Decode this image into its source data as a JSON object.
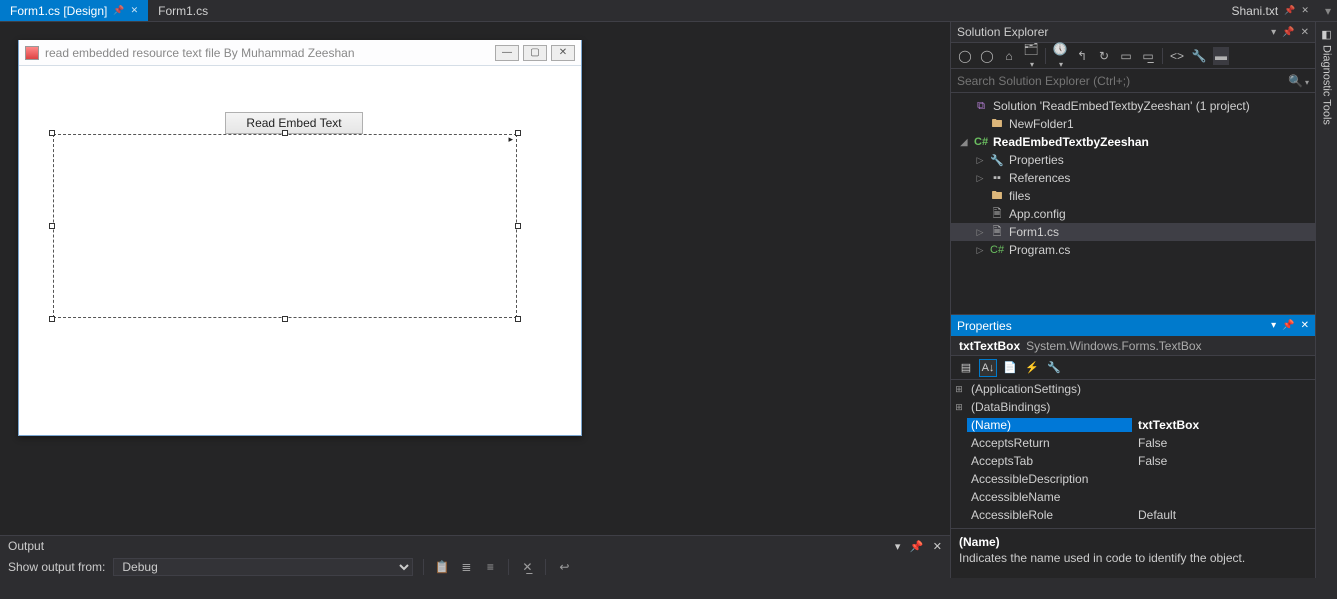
{
  "tabs": {
    "left": [
      {
        "label": "Form1.cs [Design]",
        "active": true,
        "pinned": true
      },
      {
        "label": "Form1.cs",
        "active": false
      }
    ],
    "right": [
      {
        "label": "Shani.txt"
      }
    ]
  },
  "winform": {
    "title": "read embedded resource text file By Muhammad Zeeshan",
    "button_label": "Read Embed Text"
  },
  "output": {
    "title": "Output",
    "show_from_label": "Show output from:",
    "dropdown_value": "Debug"
  },
  "solution_explorer": {
    "title": "Solution Explorer",
    "search_placeholder": "Search Solution Explorer (Ctrl+;)",
    "nodes": [
      {
        "exp": "",
        "label": "Solution 'ReadEmbedTextbyZeeshan' (1 project)",
        "icon": "sol-ico",
        "ind": 0
      },
      {
        "exp": "",
        "label": "NewFolder1",
        "icon": "folder-ico",
        "ind": 1
      },
      {
        "exp": "◢",
        "label": "ReadEmbedTextbyZeeshan",
        "icon": "cs-ico",
        "ind": 0,
        "bold": true
      },
      {
        "exp": "▷",
        "label": "Properties",
        "icon": "wrench-ico",
        "ind": 1
      },
      {
        "exp": "▷",
        "label": "References",
        "icon": "ref-ico",
        "ind": 1
      },
      {
        "exp": "",
        "label": "files",
        "icon": "folder-ico",
        "ind": 1
      },
      {
        "exp": "",
        "label": "App.config",
        "icon": "cfg-ico",
        "ind": 1
      },
      {
        "exp": "▷",
        "label": "Form1.cs",
        "icon": "cfg-ico",
        "ind": 1,
        "sel": true
      },
      {
        "exp": "▷",
        "label": "Program.cs",
        "icon": "cs-ico",
        "ind": 1
      }
    ]
  },
  "properties": {
    "title": "Properties",
    "object_name": "txtTextBox",
    "object_type": "System.Windows.Forms.TextBox",
    "rows": [
      {
        "exp": "⊞",
        "name": "(ApplicationSettings)",
        "val": "",
        "cat": true
      },
      {
        "exp": "⊞",
        "name": "(DataBindings)",
        "val": "",
        "cat": true
      },
      {
        "exp": "",
        "name": "(Name)",
        "val": "txtTextBox",
        "sel": true
      },
      {
        "exp": "",
        "name": "AcceptsReturn",
        "val": "False"
      },
      {
        "exp": "",
        "name": "AcceptsTab",
        "val": "False"
      },
      {
        "exp": "",
        "name": "AccessibleDescription",
        "val": ""
      },
      {
        "exp": "",
        "name": "AccessibleName",
        "val": ""
      },
      {
        "exp": "",
        "name": "AccessibleRole",
        "val": "Default"
      }
    ],
    "desc_name": "(Name)",
    "desc_text": "Indicates the name used in code to identify the object."
  },
  "strip": {
    "label": "Diagnostic Tools"
  }
}
